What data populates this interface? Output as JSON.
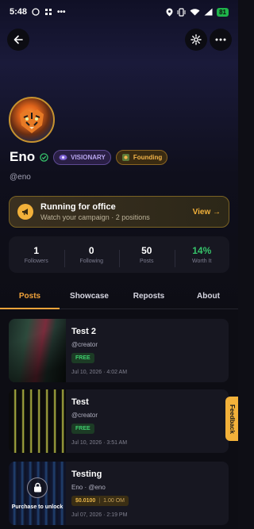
{
  "status_bar": {
    "time": "5:48",
    "battery": "81"
  },
  "profile": {
    "name": "Eno",
    "handle": "@eno",
    "badges": [
      {
        "label": "VISIONARY",
        "icon": "visionary-icon"
      },
      {
        "label": "Founding",
        "icon": "founding-icon"
      }
    ]
  },
  "campaign": {
    "title": "Running for office",
    "subtitle": "Watch your campaign · 2 positions",
    "action": "View →"
  },
  "stats": [
    {
      "value": "1",
      "label": "Followers"
    },
    {
      "value": "0",
      "label": "Following"
    },
    {
      "value": "50",
      "label": "Posts"
    },
    {
      "value": "14%",
      "label": "Worth It"
    }
  ],
  "tabs": [
    {
      "label": "Posts",
      "active": true
    },
    {
      "label": "Showcase",
      "active": false
    },
    {
      "label": "Reposts",
      "active": false
    },
    {
      "label": "About",
      "active": false
    }
  ],
  "posts": [
    {
      "title": "Test 2",
      "author": "@creator",
      "price": "FREE",
      "date": "Jul 10, 2026 · 4:02 AM"
    },
    {
      "title": "Test",
      "author": "@creator",
      "price": "FREE",
      "date": "Jul 10, 2026 · 3:51 AM"
    },
    {
      "title": "Testing",
      "author": "Eno · @eno",
      "price": "$0.0100",
      "price_unit": "1.00 OM",
      "date": "Jul 07, 2026 · 2:19 PM",
      "locked_label": "Purchase to unlock"
    }
  ],
  "feedback_label": "Feedback",
  "colors": {
    "accent": "#f2a33a",
    "free_green": "#3fcf6e",
    "worth_green": "#36c26a"
  }
}
